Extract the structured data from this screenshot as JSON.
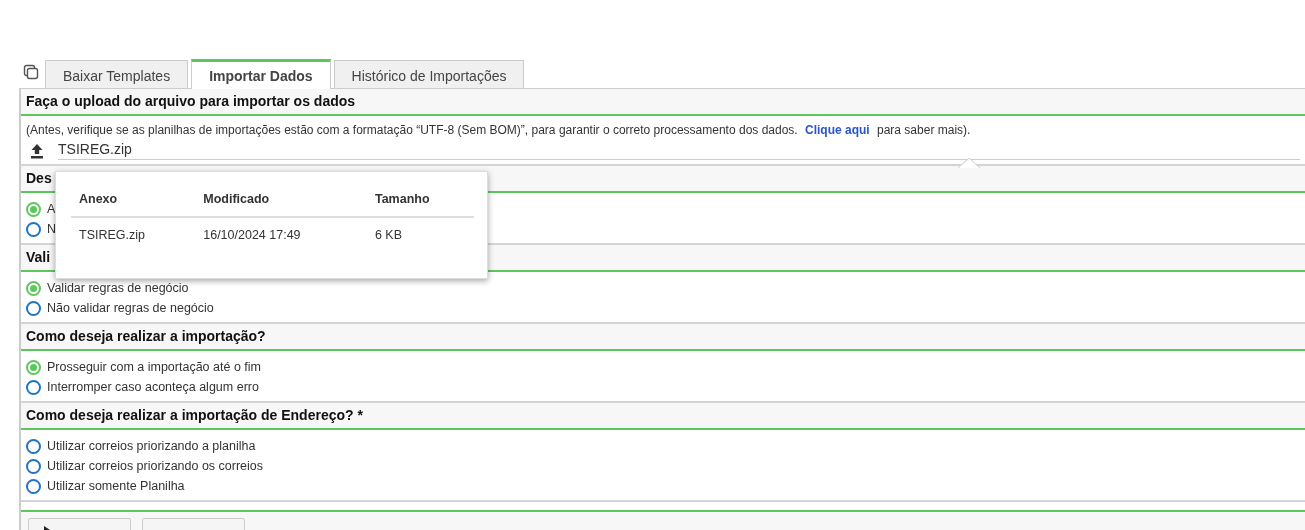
{
  "tabs": [
    {
      "label": "Baixar Templates",
      "selected": false
    },
    {
      "label": "Importar Dados",
      "selected": true
    },
    {
      "label": "Histórico de Importações",
      "selected": false
    }
  ],
  "upload": {
    "title": "Faça o upload do arquivo para importar os dados",
    "note_before": "(Antes, verifique se as planilhas de importações estão com a formatação “UTF-8 (Sem BOM)”, para garantir o correto processamento dos dados.",
    "link": "Clique aqui",
    "note_after": "para saber mais).",
    "file": "TSIREG.zip"
  },
  "sections": [
    {
      "title": "Des",
      "options": [
        {
          "label": "A",
          "selected": true
        },
        {
          "label": "N",
          "selected": false
        }
      ]
    },
    {
      "title": "Vali",
      "options": [
        {
          "label": "Validar regras de negócio",
          "selected": true
        },
        {
          "label": "Não validar regras de negócio",
          "selected": false
        }
      ]
    },
    {
      "title": "Como deseja realizar a importação?",
      "options": [
        {
          "label": "Prosseguir com a importação até o fim",
          "selected": true
        },
        {
          "label": "Interromper caso aconteça algum erro",
          "selected": false
        }
      ]
    },
    {
      "title": "Como deseja realizar a importação de Endereço? *",
      "options": [
        {
          "label": "Utilizar correios priorizando a planilha",
          "selected": false
        },
        {
          "label": "Utilizar correios priorizando os correios",
          "selected": false
        },
        {
          "label": "Utilizar somente Planilha",
          "selected": false
        }
      ]
    }
  ],
  "popup": {
    "columns": [
      "Anexo",
      "Modificado",
      "Tamanho"
    ],
    "rows": [
      [
        "TSIREG.zip",
        "16/10/2024 17:49",
        "6 KB"
      ]
    ]
  },
  "footer": {
    "buttons": [
      {
        "kind": "play"
      },
      {
        "kind": "plain"
      }
    ]
  }
}
